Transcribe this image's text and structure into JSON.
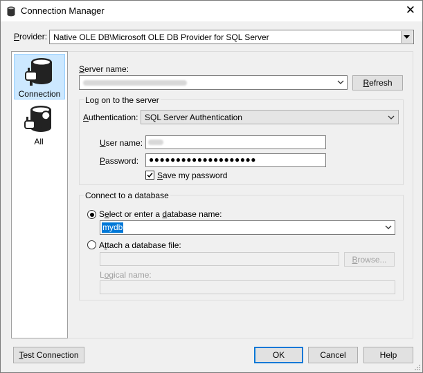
{
  "window": {
    "title": "Connection Manager",
    "close_glyph": "✕"
  },
  "provider": {
    "label": "Provider:",
    "value": "Native OLE DB\\Microsoft OLE DB Provider for SQL Server"
  },
  "nav": {
    "items": [
      {
        "label": "Connection",
        "icon": "database-plug-icon",
        "selected": true
      },
      {
        "label": "All",
        "icon": "database-wrench-icon",
        "selected": false
      }
    ]
  },
  "server": {
    "label": "Server name:",
    "value": "(blurred)",
    "refresh_label": "Refresh"
  },
  "logon": {
    "legend": "Log on to the server",
    "auth_label": "Authentication:",
    "auth_value": "SQL Server Authentication",
    "user_label": "User name:",
    "user_value": "(blurred)",
    "password_label": "Password:",
    "password_value": "●●●●●●●●●●●●●●●●●●●●",
    "save_password_label": "Save my password",
    "save_password_checked": true
  },
  "database": {
    "legend": "Connect to a database",
    "select_label": "Select or enter a database name:",
    "select_value": "mydb",
    "attach_label": "Attach a database file:",
    "browse_label": "Browse...",
    "logical_label": "Logical name:"
  },
  "footer": {
    "test_label": "Test Connection",
    "ok_label": "OK",
    "cancel_label": "Cancel",
    "help_label": "Help"
  }
}
